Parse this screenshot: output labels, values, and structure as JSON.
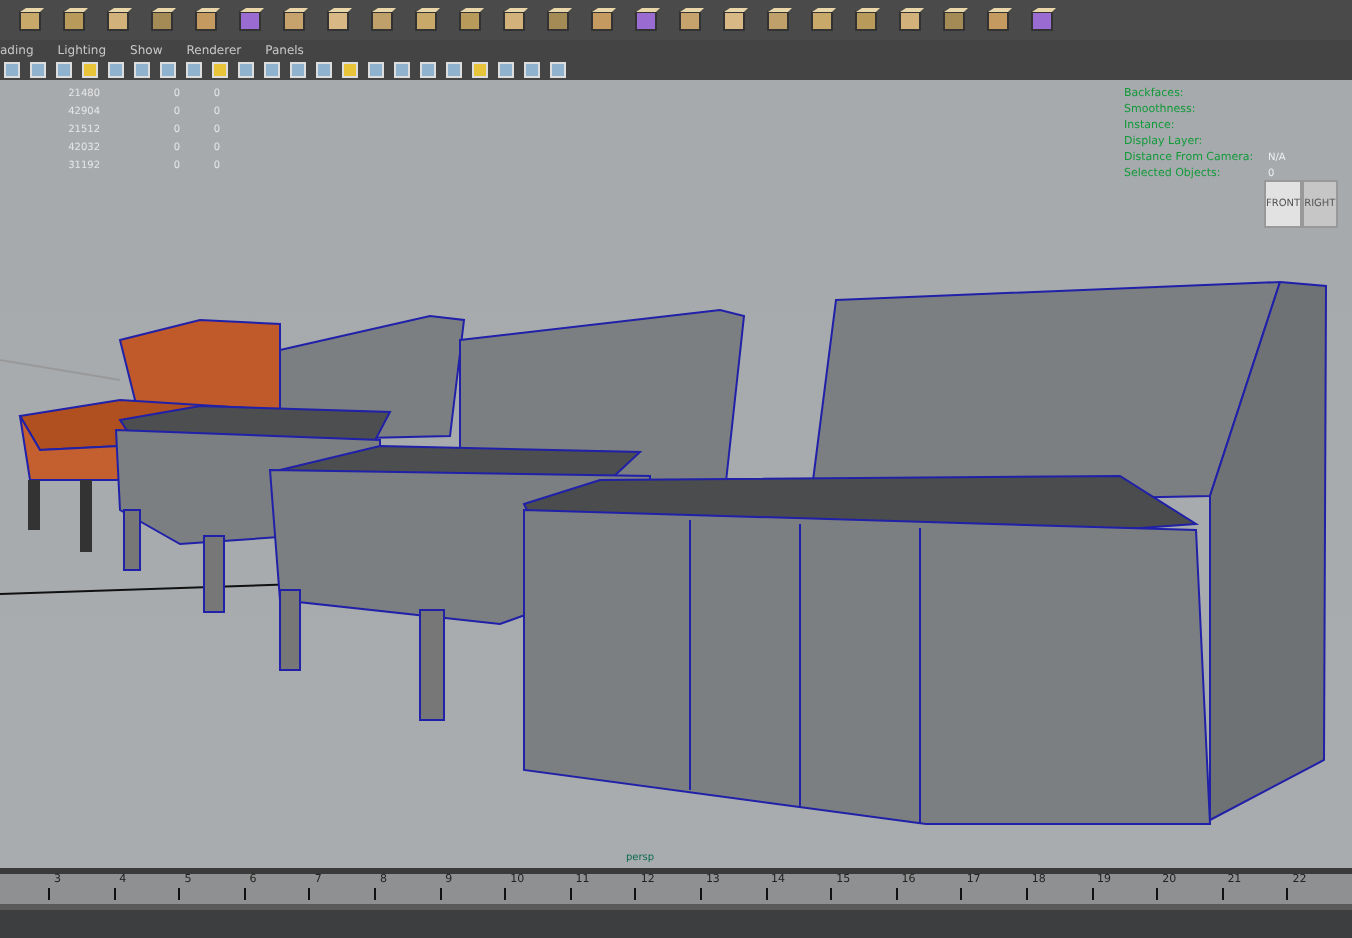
{
  "menu": [
    "ading",
    "Lighting",
    "Show",
    "Renderer",
    "Panels"
  ],
  "poly_counts": [
    {
      "column_1": "21480",
      "column_2": "0",
      "column_3": "0"
    },
    {
      "column_1": "42904",
      "column_2": "0",
      "column_3": "0"
    },
    {
      "column_1": "21512",
      "column_2": "0",
      "column_3": "0"
    },
    {
      "column_1": "42032",
      "column_2": "0",
      "column_3": "0"
    },
    {
      "column_1": "31192",
      "column_2": "0",
      "column_3": "0"
    }
  ],
  "hud": [
    {
      "label": "Backfaces:"
    },
    {
      "label": "Smoothness:"
    },
    {
      "label": "Instance:"
    },
    {
      "label": "Display Layer:"
    },
    {
      "label": "Distance From Camera:",
      "value": "N/A"
    },
    {
      "label": "Selected Objects:",
      "value": "0"
    }
  ],
  "view_cube": {
    "front": "FRONT",
    "right": "RIGHT"
  },
  "camera": "persp",
  "ruler": [
    "3",
    "4",
    "5",
    "6",
    "7",
    "8",
    "9",
    "10",
    "11",
    "12",
    "13",
    "14",
    "15",
    "16",
    "17",
    "18",
    "19",
    "20",
    "21",
    "22"
  ]
}
